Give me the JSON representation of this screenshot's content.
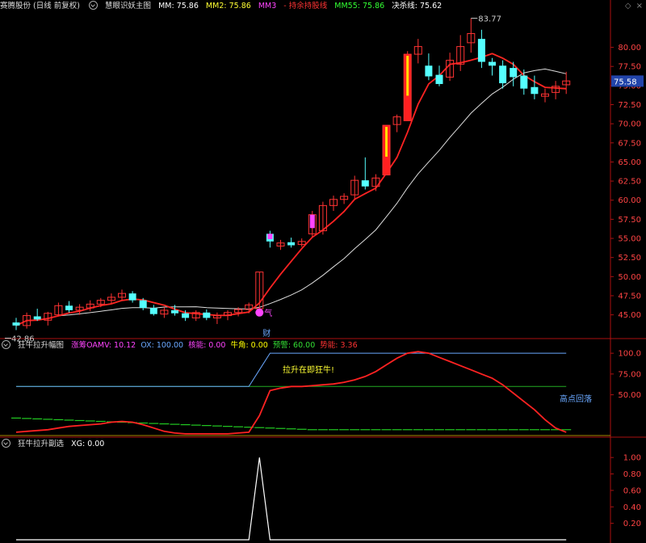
{
  "panel1": {
    "title": "赛腾股份 (日线 前复权)",
    "indicator": "慧眼识妖主图",
    "mm_label": "MM:",
    "mm": "75.86",
    "mm2_label": "MM2:",
    "mm2": "75.86",
    "mm3_label": "MM3",
    "mm4_label": "- 持余持股线",
    "mm55_label": "MM55:",
    "mm55": "75.86",
    "jcx_label": "决杀线:",
    "jcx": "75.62",
    "y_ticks": [
      "80.00",
      "77.50",
      "75.00",
      "72.50",
      "70.00",
      "67.50",
      "65.00",
      "62.50",
      "60.00",
      "57.50",
      "55.00",
      "52.50",
      "50.00",
      "47.50",
      "45.00"
    ],
    "price_tag": "75.58",
    "high_label": "83.77",
    "low_label": "42.86",
    "char_qi": "气",
    "char_cai": "财"
  },
  "panel2": {
    "title": "狂牛拉升幅图",
    "items": [
      {
        "label": "涨筹OAMV:",
        "value": "10.12",
        "color": "#ff44ff"
      },
      {
        "label": "OX:",
        "value": "100.00",
        "color": "#6aa8ff"
      },
      {
        "label": "核能:",
        "value": "0.00",
        "color": "#ff44ff"
      },
      {
        "label": "牛角:",
        "value": "0.00",
        "color": "#ffff00"
      },
      {
        "label": "预警:",
        "value": "60.00",
        "color": "#33dd33"
      },
      {
        "label": "势能:",
        "value": "3.36",
        "color": "#ff3333"
      }
    ],
    "y_ticks": [
      "100.0",
      "75.00",
      "50.00"
    ],
    "annot1": "拉升在即狂牛!",
    "annot2": "高点回落"
  },
  "panel3": {
    "title": "狂牛拉升副选",
    "xg_label": "XG:",
    "xg": "0.00",
    "y_ticks": [
      "1.00",
      "0.80",
      "0.60",
      "0.40",
      "0.20"
    ]
  },
  "colors": {
    "up": "#ff3333",
    "down": "#55ffff",
    "ma_red": "#ff2222",
    "ma_white": "#dddddd",
    "ma_green": "#22ee22",
    "axis": "#aa1111"
  },
  "chart_data": [
    {
      "type": "candlestick",
      "title": "赛腾股份 (日线 前复权)",
      "ylim": [
        42.0,
        84.5
      ],
      "ohlc": [
        [
          44.0,
          44.6,
          43.0,
          43.6
        ],
        [
          43.6,
          45.3,
          43.2,
          44.9
        ],
        [
          44.8,
          45.8,
          44.2,
          44.4
        ],
        [
          44.3,
          45.4,
          43.6,
          45.2
        ],
        [
          45.0,
          46.6,
          44.8,
          46.2
        ],
        [
          46.2,
          46.8,
          45.3,
          45.6
        ],
        [
          45.6,
          46.4,
          45.0,
          46.0
        ],
        [
          45.9,
          46.9,
          45.5,
          46.4
        ],
        [
          46.4,
          47.2,
          46.0,
          46.9
        ],
        [
          46.9,
          47.8,
          46.5,
          47.3
        ],
        [
          47.3,
          48.3,
          46.9,
          47.8
        ],
        [
          47.8,
          48.1,
          46.6,
          46.9
        ],
        [
          46.9,
          47.2,
          45.6,
          45.9
        ],
        [
          45.9,
          46.3,
          44.9,
          45.1
        ],
        [
          45.1,
          46.0,
          44.6,
          45.6
        ],
        [
          45.6,
          46.3,
          44.9,
          45.2
        ],
        [
          45.2,
          45.6,
          44.2,
          44.6
        ],
        [
          44.6,
          45.6,
          44.2,
          45.3
        ],
        [
          45.3,
          45.7,
          44.3,
          44.6
        ],
        [
          44.6,
          45.3,
          43.8,
          44.9
        ],
        [
          44.9,
          45.6,
          44.3,
          45.3
        ],
        [
          45.3,
          46.0,
          44.8,
          45.7
        ],
        [
          45.7,
          46.6,
          45.2,
          46.3
        ],
        [
          45.8,
          50.6,
          45.8,
          50.6
        ],
        [
          55.6,
          56.0,
          53.8,
          54.6
        ],
        [
          54.0,
          54.8,
          53.5,
          54.4
        ],
        [
          54.5,
          55.1,
          53.8,
          54.1
        ],
        [
          54.2,
          55.0,
          53.9,
          54.6
        ],
        [
          55.6,
          58.6,
          55.2,
          58.1
        ],
        [
          56.0,
          59.8,
          55.5,
          59.3
        ],
        [
          59.3,
          60.6,
          58.6,
          60.1
        ],
        [
          60.1,
          60.9,
          59.5,
          60.5
        ],
        [
          60.7,
          63.2,
          60.1,
          62.6
        ],
        [
          62.6,
          65.6,
          61.4,
          61.8
        ],
        [
          61.8,
          63.4,
          61.2,
          62.9
        ],
        [
          63.3,
          69.8,
          63.3,
          69.8
        ],
        [
          69.9,
          71.2,
          68.9,
          70.9
        ],
        [
          70.4,
          79.5,
          70.4,
          79.1
        ],
        [
          79.1,
          81.1,
          77.9,
          80.1
        ],
        [
          77.6,
          79.2,
          75.7,
          76.2
        ],
        [
          76.4,
          77.6,
          74.9,
          75.2
        ],
        [
          76.1,
          79.3,
          75.6,
          78.3
        ],
        [
          77.8,
          81.6,
          76.9,
          80.1
        ],
        [
          80.6,
          83.8,
          79.3,
          81.8
        ],
        [
          81.1,
          82.3,
          77.3,
          78.1
        ],
        [
          78.1,
          78.6,
          76.3,
          77.6
        ],
        [
          77.6,
          78.3,
          74.6,
          75.3
        ],
        [
          77.3,
          78.1,
          74.9,
          76.1
        ],
        [
          76.3,
          77.1,
          73.8,
          74.6
        ],
        [
          74.8,
          76.3,
          73.2,
          73.9
        ],
        [
          73.6,
          74.6,
          72.8,
          73.9
        ],
        [
          74.1,
          75.6,
          73.2,
          74.9
        ],
        [
          75.1,
          76.8,
          73.9,
          75.6
        ]
      ]
    },
    {
      "type": "line",
      "title": "狂牛拉升幅图",
      "ylim": [
        0,
        105
      ],
      "series": [
        {
          "name": "OX",
          "values": [
            60,
            60,
            60,
            60,
            60,
            60,
            60,
            60,
            60,
            60,
            60,
            60,
            60,
            60,
            60,
            60,
            60,
            60,
            60,
            60,
            60,
            60,
            60,
            80,
            100,
            100,
            100,
            100,
            100,
            100,
            100,
            100,
            100,
            100,
            100,
            100,
            100,
            100,
            100,
            100,
            100,
            100,
            100,
            100,
            100,
            100,
            100,
            100,
            100,
            100,
            100,
            100,
            100
          ]
        },
        {
          "name": "势能",
          "values": [
            5,
            6,
            7,
            8,
            10,
            12,
            13,
            14,
            15,
            17,
            18,
            17,
            14,
            10,
            6,
            4,
            3,
            3,
            3,
            3,
            3,
            4,
            5,
            25,
            55,
            58,
            60,
            60,
            61,
            62,
            63,
            65,
            68,
            72,
            78,
            86,
            94,
            100,
            102,
            100,
            95,
            90,
            85,
            80,
            75,
            70,
            62,
            52,
            42,
            32,
            20,
            10,
            5
          ]
        },
        {
          "name": "预警",
          "values": [
            60,
            60,
            60,
            60,
            60,
            60,
            60,
            60,
            60,
            60,
            60,
            60,
            60,
            60,
            60,
            60,
            60,
            60,
            60,
            60,
            60,
            60,
            60,
            60,
            60,
            60,
            60,
            60,
            60,
            60,
            60,
            60,
            60,
            60,
            60,
            60,
            60,
            60,
            60,
            60,
            60,
            60,
            60,
            60,
            60,
            60,
            60,
            60,
            60,
            60,
            60,
            60,
            60
          ]
        }
      ]
    },
    {
      "type": "line",
      "title": "狂牛拉升副选",
      "ylim": [
        0,
        1.1
      ],
      "series": [
        {
          "name": "XG",
          "values": [
            0,
            0,
            0,
            0,
            0,
            0,
            0,
            0,
            0,
            0,
            0,
            0,
            0,
            0,
            0,
            0,
            0,
            0,
            0,
            0,
            0,
            0,
            0,
            1,
            0,
            0,
            0,
            0,
            0,
            0,
            0,
            0,
            0,
            0,
            0,
            0,
            0,
            0,
            0,
            0,
            0,
            0,
            0,
            0,
            0,
            0,
            0,
            0,
            0,
            0,
            0,
            0,
            0
          ]
        }
      ]
    }
  ]
}
